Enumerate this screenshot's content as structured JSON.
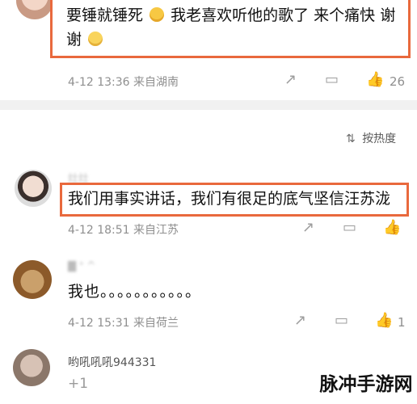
{
  "comments": [
    {
      "text_a": "要锤就锤死",
      "text_b": "我老喜欢听他的歌了 来个痛快 谢",
      "text_c": "谢",
      "meta": "4-12 13:36  来自湖南",
      "likes": "26",
      "emoji_1": "crying-emoji",
      "emoji_2": "smile-emoji"
    },
    {
      "name": "灶灶",
      "text": "我们用事实讲话，我们有很足的底气坚信汪苏泷",
      "meta": "4-12 18:51  来自江苏",
      "likes": ""
    },
    {
      "name": "▇ ᐤ ^",
      "text": "我也。。。。。。。。。。。",
      "meta": "4-12 15:31  来自荷兰",
      "likes": "1"
    },
    {
      "username": "哟吼吼吼944331",
      "reply": "+1"
    }
  ],
  "sort": {
    "label": "按热度"
  },
  "watermark": "脉冲手游网"
}
